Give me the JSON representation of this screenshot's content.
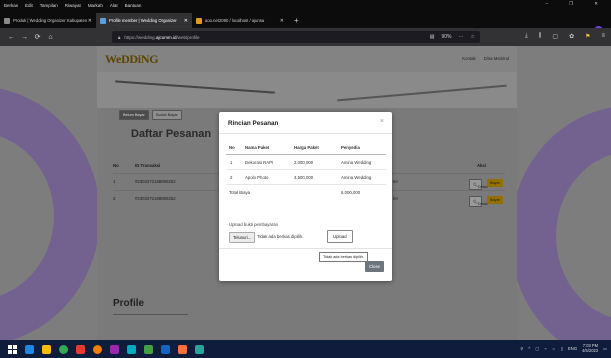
{
  "menubar": {
    "items": [
      "Berkas",
      "Edit",
      "Tampilan",
      "Riwayat",
      "Markah",
      "Alat",
      "Bantuan"
    ]
  },
  "window_controls": [
    "–",
    "❐",
    "✕"
  ],
  "tabs": [
    {
      "title": "Produk | Wedding Organizer Kabupaten",
      "active": false,
      "icon_color": "#8a8a8a"
    },
    {
      "title": "Profile member | Wedding Organizer",
      "active": true,
      "icon_color": "#5a9fe0"
    },
    {
      "title": "aoo.net2090 / localhost / ajunsa",
      "active": false,
      "icon_color": "#e49b1c"
    }
  ],
  "new_tab": "+",
  "nav": {
    "back": "←",
    "forward": "→",
    "reload": "⟳",
    "home": "⌂",
    "url_prefix": "https://wedding.",
    "url_domain": "ajcomm.id",
    "url_path": "/web/profile",
    "zoom": "90%",
    "more": "···",
    "bookmark": "☆",
    "right_icons": [
      "⤓",
      "⫼",
      "▢",
      "✿",
      "⚑",
      "≡"
    ]
  },
  "site": {
    "logo": "WeDDiNG",
    "nav_links": [
      "Kontak",
      "Dina Maitrind"
    ],
    "pills": [
      "Belum Bayar",
      "Sudah Bayar"
    ],
    "page_title": "Daftar Pesanan",
    "table_headers": [
      "No",
      "ID Transaksi",
      "Aksi"
    ],
    "rows": [
      {
        "no": "1",
        "id": "#2303272188898252",
        "status": "ter"
      },
      {
        "no": "2",
        "id": "#2303272188898252",
        "status": "ter"
      }
    ],
    "detail_label": "Detail",
    "bayar_label": "Bayar",
    "profile_title": "Profile"
  },
  "modal": {
    "title": "Rincian Pesanan",
    "close_icon": "×",
    "headers": [
      "No",
      "Nama Paket",
      "Harga Paket",
      "Penyedia"
    ],
    "rows": [
      {
        "no": "1",
        "nama": "Dekorasi RAPI",
        "harga": "2,000,000",
        "penyedia": "Amina Wedding"
      },
      {
        "no": "2",
        "nama": "Apolo Photo",
        "harga": "4,500,000",
        "penyedia": "Amina Wedding"
      }
    ],
    "total_label": "Total Biaya",
    "total_value": "6,000,000",
    "upload_label": "Upload bukti pembayaran",
    "file_button": "Telusuri...",
    "file_text": "Tidak ada berkas dipilih.",
    "upload_button": "Upload",
    "tooltip": "Tidak ada berkas dipilih.",
    "close_button": "Close"
  },
  "taskbar": {
    "icons": [
      "#1e88e5",
      "#fbbc04",
      "#34a853",
      "#e53935",
      "#f57c00",
      "#9c27b0",
      "#00acc1",
      "#43a047",
      "#1565c0",
      "#ff7043",
      "#26a69a"
    ],
    "tray_icons": [
      "⚲",
      "^",
      "▢",
      "⌁",
      "☼",
      "▯"
    ],
    "lang": "ENG",
    "time": "7:03 PM",
    "date": "4/5/2023"
  }
}
